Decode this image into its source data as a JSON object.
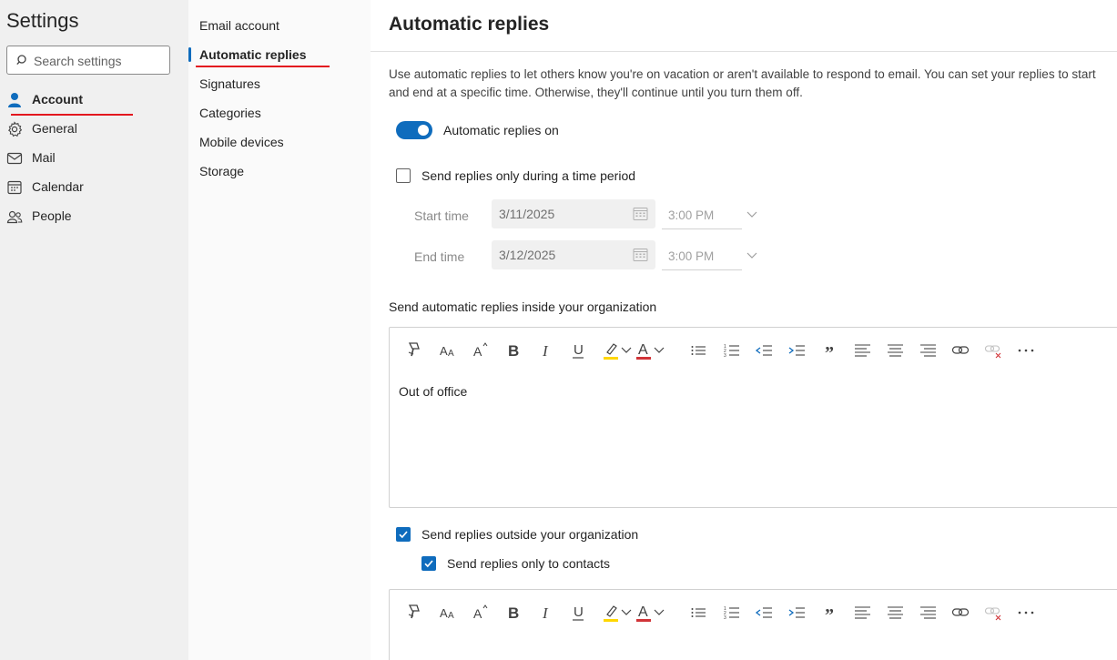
{
  "app": {
    "title": "Settings"
  },
  "search": {
    "placeholder": "Search settings"
  },
  "nav": {
    "items": [
      {
        "label": "Account",
        "active": true
      },
      {
        "label": "General"
      },
      {
        "label": "Mail"
      },
      {
        "label": "Calendar"
      },
      {
        "label": "People"
      }
    ]
  },
  "subnav": {
    "items": [
      {
        "label": "Email account"
      },
      {
        "label": "Automatic replies",
        "active": true
      },
      {
        "label": "Signatures"
      },
      {
        "label": "Categories"
      },
      {
        "label": "Mobile devices"
      },
      {
        "label": "Storage"
      }
    ]
  },
  "page": {
    "title": "Automatic replies",
    "description": "Use automatic replies to let others know you're on vacation or aren't available to respond to email. You can set your replies to start and end at a specific time. Otherwise, they'll continue until you turn them off.",
    "toggle_label": "Automatic replies on",
    "toggle_on": true,
    "time_period_label": "Send replies only during a time period",
    "time_period_checked": false,
    "start": {
      "label": "Start time",
      "date": "3/11/2025",
      "time": "3:00 PM"
    },
    "end": {
      "label": "End time",
      "date": "3/12/2025",
      "time": "3:00 PM"
    },
    "inside_label": "Send automatic replies inside your organization",
    "inside_message": "Out of office",
    "outside_label": "Send replies outside your organization",
    "outside_checked": true,
    "contacts_label": "Send replies only to contacts",
    "contacts_checked": true
  },
  "colors": {
    "accent": "#0f6cbd",
    "highlight_marker": "#ffd700",
    "font_color_marker": "#d13438",
    "annotation_underline": "#e3171f"
  }
}
